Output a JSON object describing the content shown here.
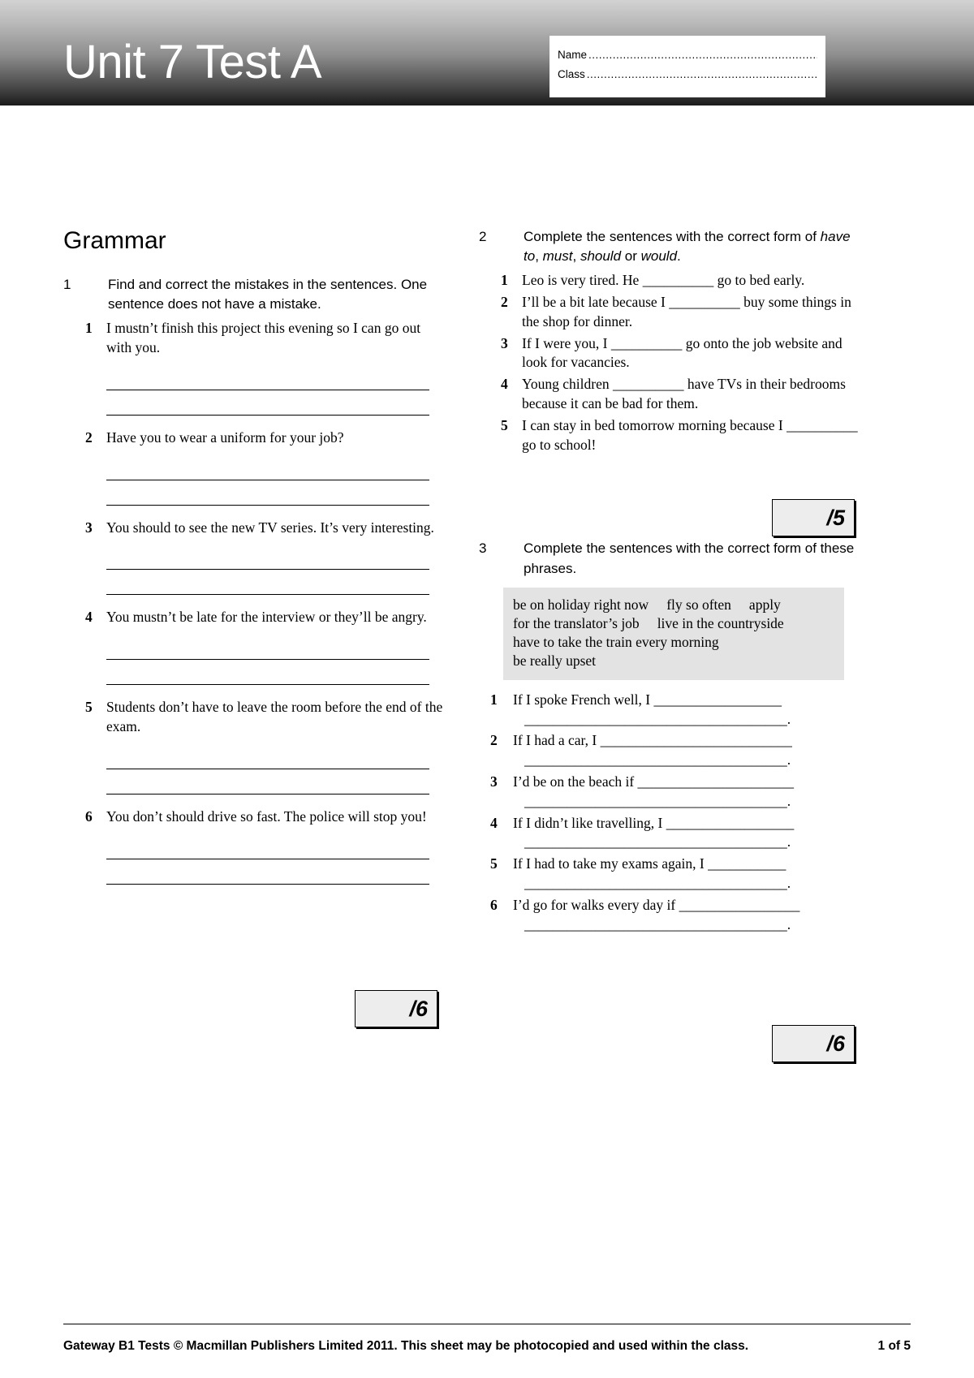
{
  "header": {
    "title": "Unit 7 Test A",
    "name_label": "Name",
    "class_label": "Class",
    "dots": "...........................................................................................",
    "gradient_from": "#d2d2d2",
    "gradient_to": "#1a1a1a",
    "title_color": "#ffffff"
  },
  "section": {
    "title": "Grammar"
  },
  "colors": {
    "score_box_bg": "#ededed",
    "phrase_box_bg": "#e3e3e3",
    "rule": "#000000"
  },
  "exercise1": {
    "number": "1",
    "instruction": "Find and correct the mistakes in the sentences. One sentence does not have a mistake.",
    "items": [
      {
        "num": "1",
        "text": "I mustn’t finish this project this evening so I can go out with you."
      },
      {
        "num": "2",
        "text": "Have you to wear a uniform for your job?"
      },
      {
        "num": "3",
        "text": "You should to see the new TV series. It’s very interesting."
      },
      {
        "num": "4",
        "text": "You mustn’t be late for the interview or they’ll be angry."
      },
      {
        "num": "5",
        "text": "Students don’t have to leave the room before the end of the exam."
      },
      {
        "num": "6",
        "text": "You don’t should drive so fast. The police will stop you!"
      }
    ],
    "answer_lines_per_item": 2,
    "score": "/6"
  },
  "exercise2": {
    "number": "2",
    "instruction_part1": "Complete the sentences with the correct form of ",
    "instruction_italic1": "have to",
    "instruction_sep1": ", ",
    "instruction_italic2": "must",
    "instruction_sep2": ", ",
    "instruction_italic3": "should",
    "instruction_sep3": " or ",
    "instruction_italic4": "would",
    "instruction_end": ".",
    "blank": "__________",
    "items": [
      {
        "num": "1",
        "before": "Leo is very tired. He ",
        "after": " go to bed early."
      },
      {
        "num": "2",
        "before": "I’ll be a bit late because I ",
        "after": " buy some things in the shop for dinner."
      },
      {
        "num": "3",
        "before": "If I were you, I ",
        "after": " go onto the job website and look for vacancies."
      },
      {
        "num": "4",
        "before": "Young children ",
        "after": " have TVs in their bedrooms because it can be bad for them."
      },
      {
        "num": "5",
        "before": "I can stay in bed tomorrow morning because I ",
        "after": " go to school!"
      }
    ],
    "score": "/5"
  },
  "exercise3": {
    "number": "3",
    "instruction": "Complete the sentences with the correct form of these phrases.",
    "phrase_box": [
      [
        "be on holiday right now",
        "fly so often",
        "apply"
      ],
      [
        "for the translator’s job",
        "live in the countryside"
      ],
      [
        "have to take the train every morning"
      ],
      [
        "be really upset"
      ]
    ],
    "blank_short": "_________________",
    "blank_long": "_____________________________________",
    "items": [
      {
        "num": "1",
        "before": "If I spoke French well, I ",
        "blank": "__________________",
        "cont": "_____________________________________."
      },
      {
        "num": "2",
        "before": "If I had a car, I ",
        "blank": "___________________________",
        "cont": "_____________________________________."
      },
      {
        "num": "3",
        "before": "I’d be on the beach if ",
        "blank": "______________________",
        "cont": "_____________________________________."
      },
      {
        "num": "4",
        "before": "If I didn’t like travelling, I ",
        "blank": "__________________",
        "cont": "_____________________________________."
      },
      {
        "num": "5",
        "before": "If I had to take my exams again, I ",
        "blank": "___________",
        "cont": "_____________________________________."
      },
      {
        "num": "6",
        "before": "I’d go for walks every day if ",
        "blank": "_________________",
        "cont": "_____________________________________."
      }
    ],
    "score": "/6"
  },
  "footer": {
    "copyright": "Gateway B1 Tests © Macmillan Publishers Limited 2011. This sheet may be photocopied and used within the class.",
    "page": "1 of 5"
  }
}
